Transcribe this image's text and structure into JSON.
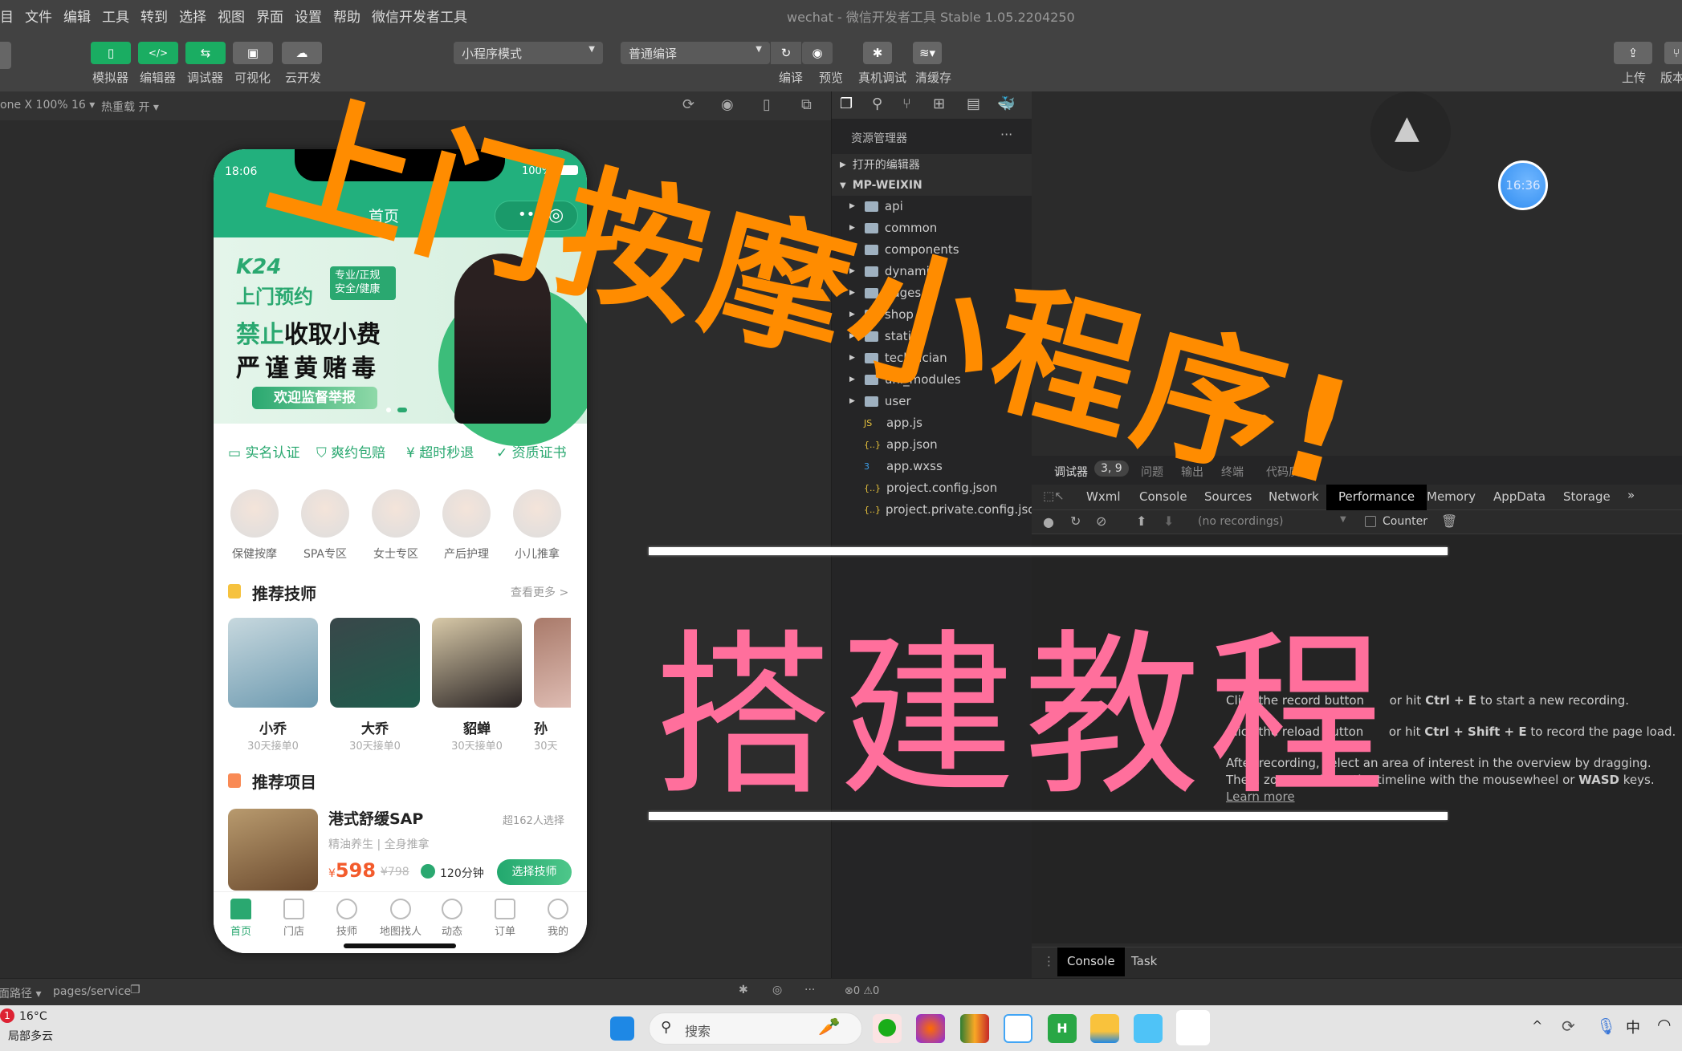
{
  "menu": {
    "items": [
      "目",
      "文件",
      "编辑",
      "工具",
      "转到",
      "选择",
      "视图",
      "界面",
      "设置",
      "帮助",
      "微信开发者工具"
    ],
    "window_title": "wechat - 微信开发者工具 Stable 1.05.2204250"
  },
  "toolbar": {
    "left_buttons": [
      {
        "label": "模拟器",
        "icon": "phone-icon"
      },
      {
        "label": "编辑器",
        "icon": "code-icon"
      },
      {
        "label": "调试器",
        "icon": "debug-icon"
      },
      {
        "label": "可视化",
        "icon": "layout-icon"
      },
      {
        "label": "云开发",
        "icon": "cloud-icon"
      }
    ],
    "mode_select": "小程序模式",
    "compile_select": "普通编译",
    "right_buttons": [
      {
        "label": "编译",
        "icon": "refresh-icon"
      },
      {
        "label": "预览",
        "icon": "eye-icon"
      },
      {
        "label": "真机调试",
        "icon": "bug-icon"
      },
      {
        "label": "清缓存",
        "icon": "layers-icon"
      }
    ],
    "upload_label": "上传",
    "version_label": "版本"
  },
  "simbar": {
    "device": "one X 100% 16 ▾",
    "hot_reload": "热重载 开 ▾"
  },
  "phone": {
    "time": "18:06",
    "battery": "100%",
    "nav_title": "首页",
    "banner": {
      "brand": "K24",
      "line1": "上门预约",
      "tag1": "专业/正规",
      "tag2": "安全/健康",
      "slogan_green": "禁止",
      "slogan1_rest": "收取小费",
      "slogan2": "严谨黄赌毒",
      "button": "欢迎监督举报"
    },
    "features": [
      "实名认证",
      "爽约包赔",
      "超时秒退",
      "资质证书"
    ],
    "categories": [
      "保健按摩",
      "SPA专区",
      "女士专区",
      "产后护理",
      "小儿推拿"
    ],
    "tech_section": {
      "title": "推荐技师",
      "more": "查看更多 >"
    },
    "technicians": [
      {
        "name": "小乔",
        "stat": "30天接单0"
      },
      {
        "name": "大乔",
        "stat": "30天接单0"
      },
      {
        "name": "貂蝉",
        "stat": "30天接单0"
      },
      {
        "name": "孙",
        "stat": "30天"
      }
    ],
    "project_section": {
      "title": "推荐项目"
    },
    "project": {
      "name": "港式舒缓SAP",
      "popularity": "超162人选择",
      "desc": "精油养生 | 全身推拿",
      "currency": "¥",
      "price": "598",
      "original_price": "¥798",
      "duration": "120分钟",
      "button": "选择技师"
    },
    "tabs": [
      "首页",
      "门店",
      "技师",
      "地图找人",
      "动态",
      "订单",
      "我的"
    ],
    "active_tab": "首页"
  },
  "explorer": {
    "title": "资源管理器",
    "open_editors": "打开的编辑器",
    "project": "MP-WEIXIN",
    "folders": [
      "api",
      "common",
      "components",
      "dynamic",
      "pages",
      "shop",
      "static",
      "technician",
      "uni_modules",
      "user"
    ],
    "files": [
      {
        "name": "app.js",
        "type": "js"
      },
      {
        "name": "app.json",
        "type": "json"
      },
      {
        "name": "app.wxss",
        "type": "css"
      },
      {
        "name": "project.config.json",
        "type": "json"
      },
      {
        "name": "project.private.config.json",
        "type": "json"
      }
    ]
  },
  "devtools": {
    "top_tabs": [
      "调试器",
      "问题",
      "输出",
      "终端",
      "代码质量"
    ],
    "badge": "3, 9",
    "tabs": [
      "Wxml",
      "Console",
      "Sources",
      "Network",
      "Performance",
      "Memory",
      "AppData",
      "Storage"
    ],
    "active_tab": "Performance",
    "recordings": "(no recordings)",
    "counter_label": "Counter",
    "help": {
      "line1_pre": "Click the record button",
      "line1_mid": "or hit",
      "line1_key": "Ctrl + E",
      "line1_post": "to start a new recording.",
      "line2_pre": "Click the reload button",
      "line2_mid": "or hit",
      "line2_key": "Ctrl + Shift + E",
      "line2_post": "to record the page load.",
      "line3": "After recording, select an area of interest in the overview by dragging.",
      "line4_pre": "Then, zoom and pan the timeline with the mousewheel or",
      "line4_key": "WASD",
      "line4_post": "keys.",
      "learn_more": "Learn more"
    },
    "drawer_tabs": [
      "Console",
      "Task"
    ]
  },
  "timer_badge": "16:36",
  "statusbar": {
    "path_label": "页面路径 ▾",
    "path": "pages/service",
    "errors": "0",
    "warnings": "0"
  },
  "taskbar": {
    "weather_badge": "1",
    "temperature": "16°C",
    "weather": "局部多云",
    "search_placeholder": "搜索",
    "ime": "中"
  },
  "overlay": {
    "title": "上门按摩小程序!",
    "subtitle": "搭建教程",
    "title_color": "#ff8c00",
    "subtitle_color": "#ff6f9c"
  }
}
